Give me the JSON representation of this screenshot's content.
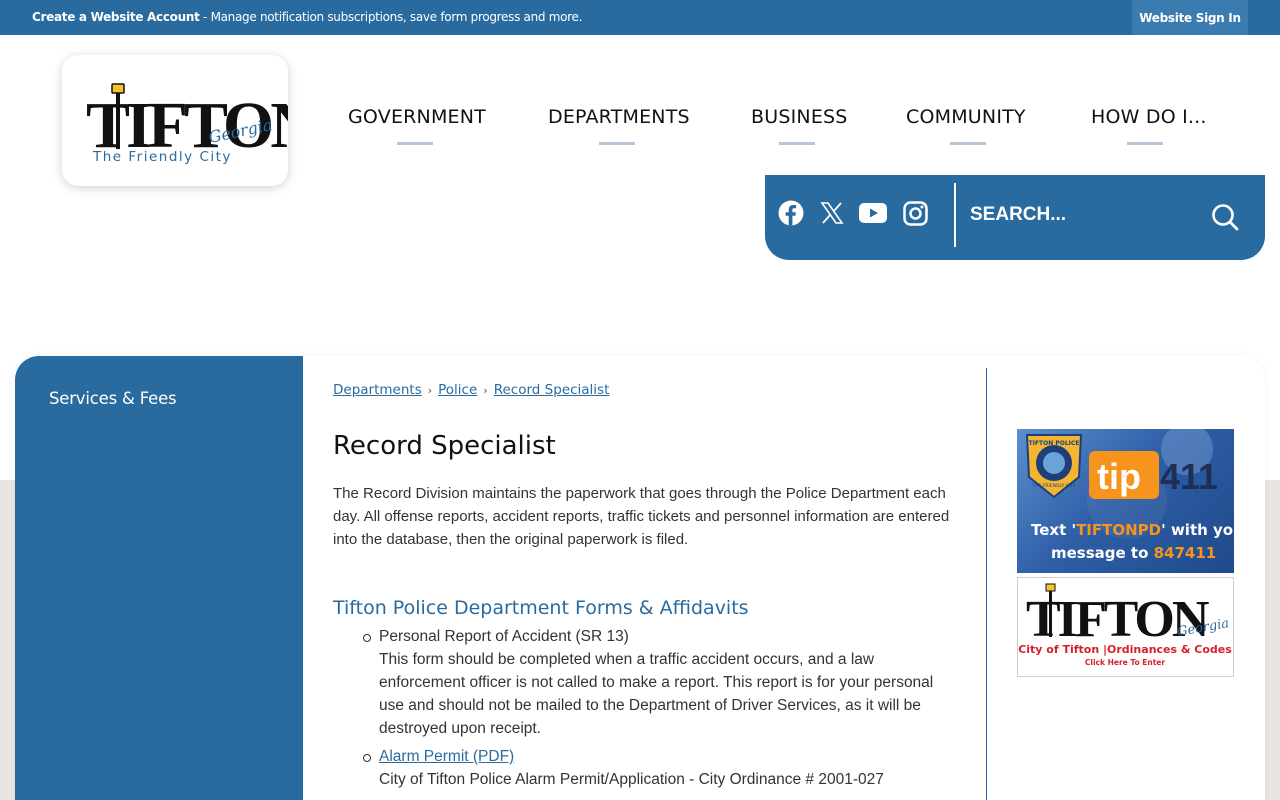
{
  "topbar": {
    "create_account": "Create a Website Account",
    "tagline": " - Manage notification subscriptions, save form progress and more.",
    "signin": "Website Sign In"
  },
  "logo": {
    "title": "TIFTON",
    "state": "Georgia",
    "slogan": "The Friendly City"
  },
  "nav": [
    "GOVERNMENT",
    "DEPARTMENTS",
    "BUSINESS",
    "COMMUNITY",
    "HOW DO I..."
  ],
  "social": [
    "facebook-icon",
    "x-icon",
    "youtube-icon",
    "instagram-icon"
  ],
  "search": {
    "placeholder": "SEARCH..."
  },
  "sidebar": {
    "items": [
      {
        "label": "Services & Fees"
      }
    ]
  },
  "breadcrumb": [
    "Departments",
    "Police",
    "Record Specialist"
  ],
  "page_title": "Record Specialist",
  "intro": "The Record Division maintains the paperwork that goes through the Police Department each day. All offense reports, accident reports, traffic tickets and personnel information are entered into the database, then the original paperwork is filed.",
  "section_title": "Tifton Police Department Forms & Affidavits",
  "forms": [
    {
      "title": "Personal Report of Accident (SR 13)",
      "description": "This form should be completed when a traffic accident occurs, and a law enforcement officer is not called to make a report. This report is for your personal use and should not be mailed to the Department of Driver Services, as it will be destroyed upon receipt."
    },
    {
      "title": "Alarm Permit (PDF)",
      "description": "City of Tifton Police Alarm Permit/Application - City Ordinance # 2001-027"
    }
  ],
  "banners": {
    "tip411": {
      "seal_top": "TIFTON POLICE",
      "seal_bottom": "THE FRIENDLY CITY",
      "brand_a": "tip",
      "brand_b": "411",
      "line1_a": "Text '",
      "line1_b": "TIFTONPD",
      "line1_c": "' with your",
      "line2_a": "message to ",
      "line2_b": "847411"
    },
    "ordinances": {
      "title": "TIFTON",
      "state": "Georgia",
      "line1": "City of Tifton |Ordinances & Codes",
      "line2": "Click Here To Enter"
    }
  },
  "colors": {
    "primary": "#2a6b9f",
    "accent_orange": "#f7941d",
    "background_band": "#e9e6e1"
  }
}
